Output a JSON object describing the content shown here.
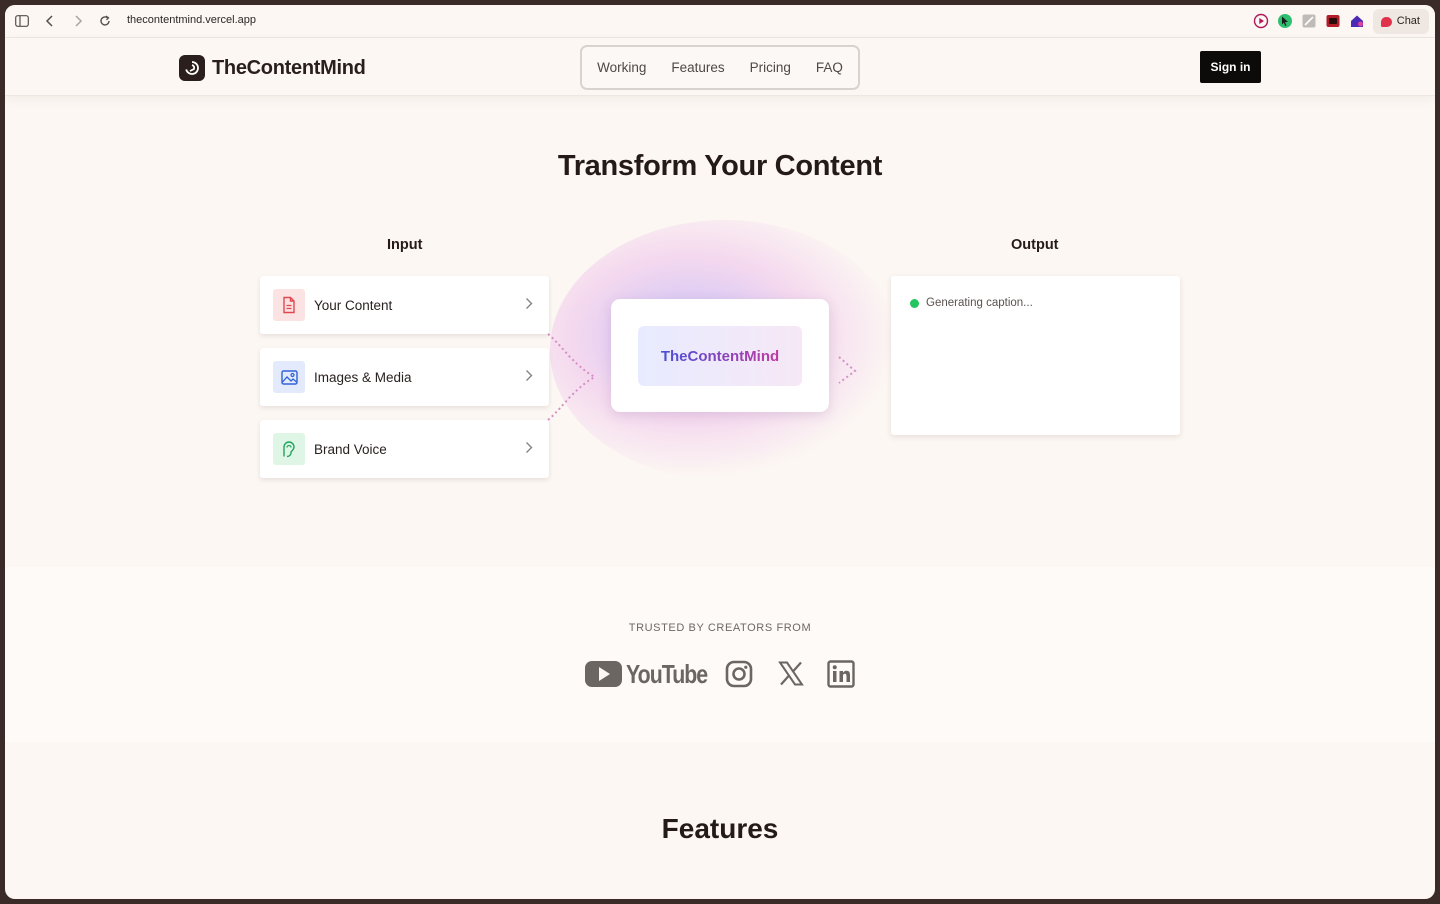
{
  "browser": {
    "url": "thecontentmind.vercel.app",
    "chat_label": "Chat",
    "icons": [
      "sidebar-toggle-icon",
      "back-icon",
      "forward-icon",
      "reload-icon"
    ]
  },
  "nav": {
    "brand": "TheContentMind",
    "links": [
      "Working",
      "Features",
      "Pricing",
      "FAQ"
    ],
    "signin": "Sign in"
  },
  "hero": {
    "title": "Transform Your Content",
    "input_label": "Input",
    "output_label": "Output",
    "inputs": [
      {
        "label": "Your Content",
        "icon": "document-icon",
        "color": "#e0484f",
        "bg": "#fbe3e3"
      },
      {
        "label": "Images & Media",
        "icon": "image-icon",
        "color": "#2f62d6",
        "bg": "#e2eafc"
      },
      {
        "label": "Brand Voice",
        "icon": "voice-icon",
        "color": "#23a55a",
        "bg": "#dff5e6"
      }
    ],
    "engine": "TheContentMind",
    "status": "Generating caption..."
  },
  "trusted": {
    "label": "TRUSTED BY CREATORS FROM",
    "logos": [
      "YouTube",
      "Instagram",
      "X",
      "LinkedIn"
    ]
  },
  "features": {
    "title": "Features"
  },
  "colors": {
    "background": "#fcf7f3",
    "text": "#241a17",
    "accent_start": "#4a4fd8",
    "accent_end": "#c03aa0",
    "status": "#22c55e"
  }
}
